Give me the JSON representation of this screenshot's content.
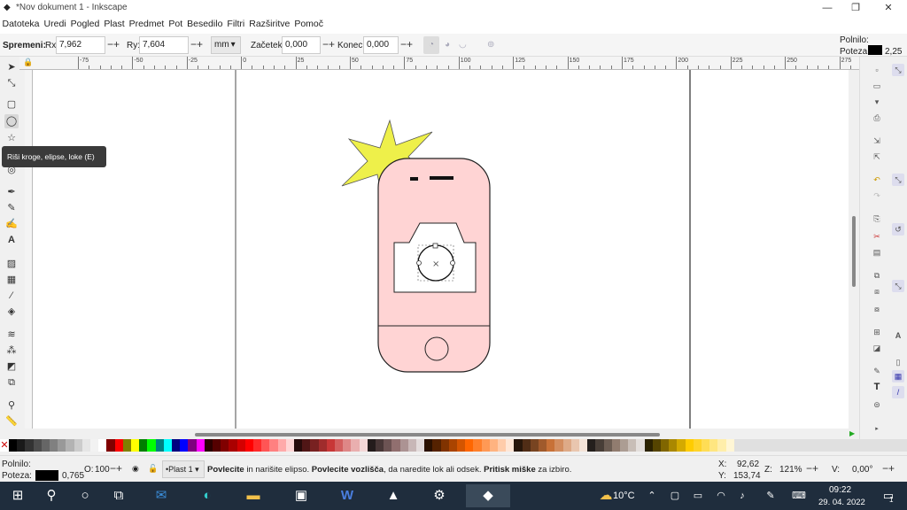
{
  "titlebar": {
    "title": "*Nov dokument 1 - Inkscape",
    "min": "—",
    "max": "❐",
    "close": "✕"
  },
  "menu": [
    "Datoteka",
    "Uredi",
    "Pogled",
    "Plast",
    "Predmet",
    "Pot",
    "Besedilo",
    "Filtri",
    "Razširitve",
    "Pomoč"
  ],
  "toolctrl": {
    "label": "Spremeni:",
    "rx_label": "Rx:",
    "rx": "7,962",
    "ry_label": "Ry:",
    "ry": "7,604",
    "unit": "mm",
    "start_label": "Začetek:",
    "start": "0,000",
    "end_label": "Konec:",
    "end": "0,000",
    "fill_label": "Polnilo:",
    "stroke_label": "Poteza:",
    "stroke_width": "2,25"
  },
  "ruler": [
    "-75",
    "-50",
    "-25",
    "0",
    "25",
    "50",
    "75",
    "100",
    "125",
    "150",
    "175",
    "200",
    "225",
    "250",
    "275"
  ],
  "tooltip": "Riši kroge, elipse, loke (E)",
  "status": {
    "fill_label": "Polnilo:",
    "stroke_label": "Poteza:",
    "stroke_width": "0,765",
    "opacity_label": "O:",
    "opacity": "100",
    "layer": "•Plast 1",
    "msg_a": "Povlecite",
    "msg_b": " in narišite elipso. ",
    "msg_c": "Povlecite vozlišča",
    "msg_d": ", da naredite lok ali odsek. ",
    "msg_e": "Pritisk miške",
    "msg_f": " za izbiro.",
    "x_label": "X:",
    "x": "92,62",
    "y_label": "Y:",
    "y": "153,74",
    "zoom_label": "Z:",
    "zoom": "121%",
    "rot_label": "V:",
    "rot": "0,00°"
  },
  "taskbar": {
    "temp": "10°C",
    "time": "09:22",
    "date": "29. 04. 2022",
    "notif": "1"
  },
  "colors": {
    "phone_body": "#ffd4d4",
    "star": "#eef04a",
    "accent": "#1f2d3d"
  }
}
